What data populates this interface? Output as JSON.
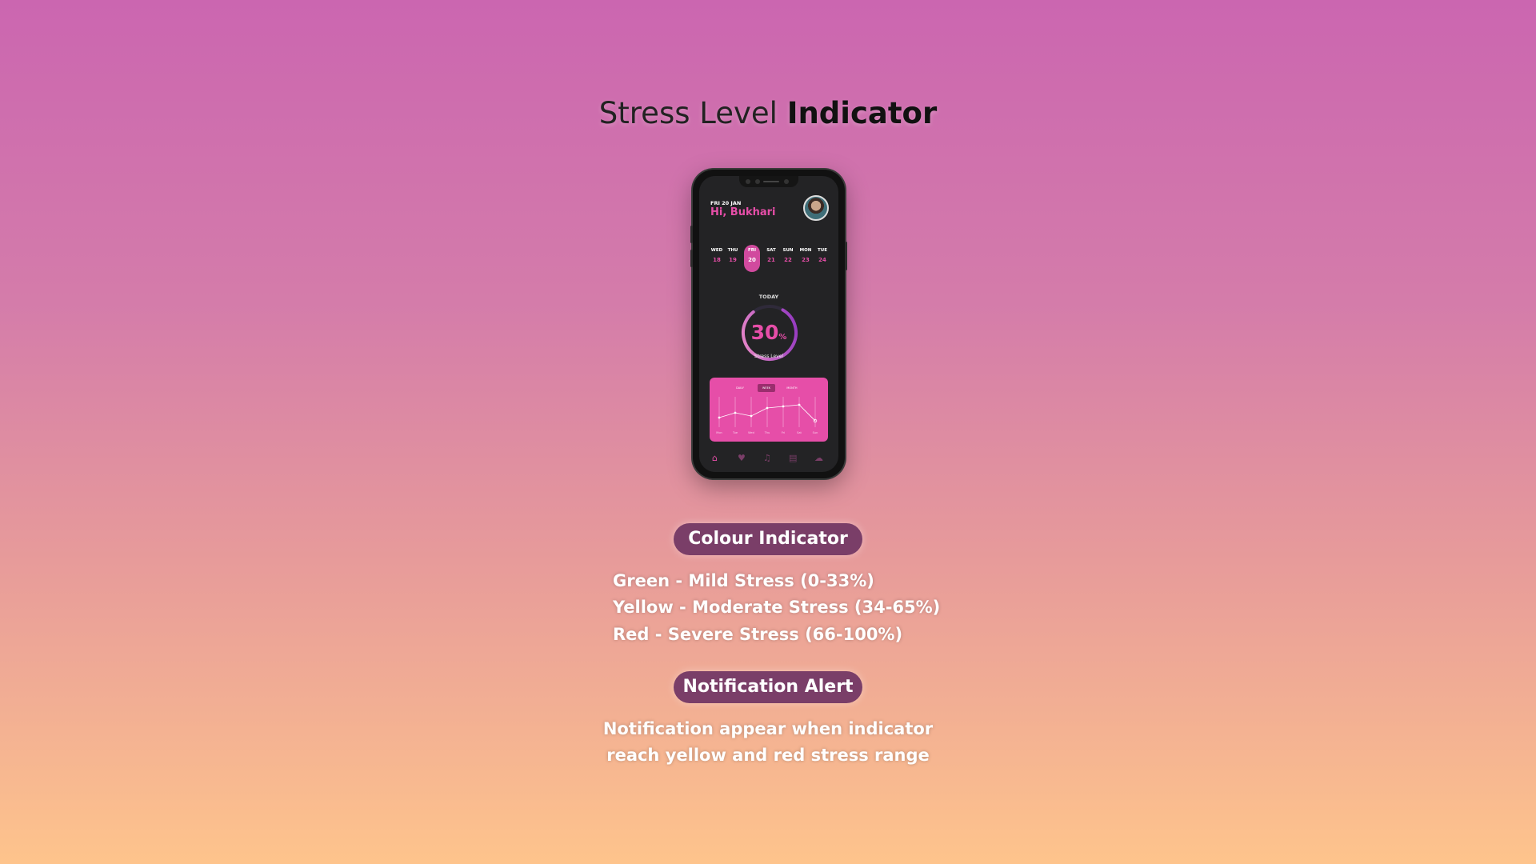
{
  "title": {
    "regular": "Stress Level ",
    "bold": "Indicator"
  },
  "app": {
    "date_label": "FRI 20 JAN",
    "greeting": "Hi, Bukhari",
    "days": [
      {
        "name": "WED",
        "date": "18"
      },
      {
        "name": "THU",
        "date": "19"
      },
      {
        "name": "FRI",
        "date": "20"
      },
      {
        "name": "SAT",
        "date": "21"
      },
      {
        "name": "SUN",
        "date": "22"
      },
      {
        "name": "MON",
        "date": "23"
      },
      {
        "name": "TUE",
        "date": "24"
      }
    ],
    "selected_day": "FRI",
    "today_label": "TODAY",
    "stress_value": "30",
    "stress_value_fraction": 0.3,
    "stress_unit": "%",
    "stress_label": "Stress Level",
    "tabs": [
      "DAILY",
      "WEEK",
      "MONTH"
    ],
    "selected_tab": "WEEK",
    "chart_days": [
      "Mon",
      "Tue",
      "Wed",
      "Thu",
      "Fri",
      "Sat",
      "Sun"
    ],
    "nav_icons": [
      "home-icon",
      "heart-icon",
      "music-icon",
      "journal-icon",
      "cloud-icon"
    ]
  },
  "colour_indicator": {
    "heading": "Colour Indicator",
    "lines": [
      "Green - Mild Stress (0-33%)",
      "Yellow - Moderate Stress (34-65%)",
      "Red - Severe Stress (66-100%)"
    ]
  },
  "notification": {
    "heading": "Notification Alert",
    "lines": [
      "Notification appear when indicator",
      "reach yellow and red stress range"
    ]
  },
  "colors": {
    "accent": "#E64EA8",
    "screen_bg": "#232325",
    "pill_bg": "#7A3E68"
  }
}
